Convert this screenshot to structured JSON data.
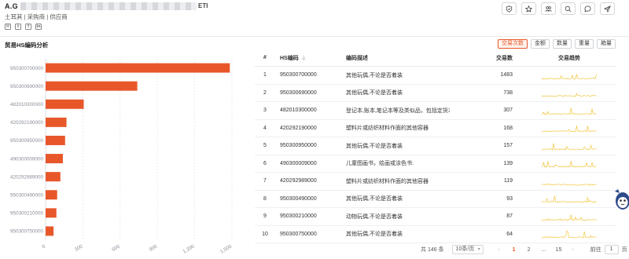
{
  "company": {
    "name": "A.G",
    "name_suffix": "ETI",
    "tags": "土耳其 | 采购商 | 供应商",
    "social_icons": [
      "mail-icon",
      "twitter-icon",
      "facebook-icon",
      "linkedin-icon"
    ]
  },
  "header_actions": [
    "shield-icon",
    "star-icon",
    "users-icon",
    "search-icon",
    "chat-icon",
    "share-icon"
  ],
  "panel": {
    "title": "贸易HS编码分析",
    "metric_tabs": [
      {
        "label": "交易次数",
        "active": true
      },
      {
        "label": "金额",
        "active": false
      },
      {
        "label": "数量",
        "active": false
      },
      {
        "label": "重量",
        "active": false
      },
      {
        "label": "箱量",
        "active": false
      }
    ]
  },
  "chart_data": {
    "type": "bar",
    "orientation": "horizontal",
    "categories": [
      "950300700000",
      "950300690000",
      "482010300000",
      "420292190000",
      "950300950000",
      "490300009000",
      "420292989000",
      "950300490000",
      "950300210000",
      "950300750000"
    ],
    "values": [
      1483,
      738,
      307,
      168,
      157,
      139,
      119,
      93,
      87,
      64
    ],
    "xticks": [
      "0",
      "300",
      "600",
      "900",
      "1,200",
      "1,500"
    ],
    "xlim": [
      0,
      1500
    ],
    "color": "#e8572a",
    "grid": "vertical dashed"
  },
  "table": {
    "headers": {
      "idx": "#",
      "hs": "HS编码",
      "desc": "编码描述",
      "count": "交易数",
      "trend": "交易趋势"
    },
    "rows": [
      {
        "idx": "1",
        "hs": "950300700000",
        "desc": "其他玩偶,不论是否着装",
        "count": "1483"
      },
      {
        "idx": "2",
        "hs": "950300690000",
        "desc": "其他玩偶,不论是否着装",
        "count": "738"
      },
      {
        "idx": "3",
        "hs": "482010300000",
        "desc": "登记本,账本,笔记本等及类似品，包括定货本,收...",
        "count": "307"
      },
      {
        "idx": "4",
        "hs": "420292190000",
        "desc": "塑料片或纺织材料作面的其他容器",
        "count": "168"
      },
      {
        "idx": "5",
        "hs": "950300950000",
        "desc": "其他玩偶,不论是否着装",
        "count": "157"
      },
      {
        "idx": "6",
        "hs": "490300009000",
        "desc": "儿童图画书，绘画或涂色书:",
        "count": "139"
      },
      {
        "idx": "7",
        "hs": "420292989000",
        "desc": "塑料片或纺织材料作面的其他容器",
        "count": "119"
      },
      {
        "idx": "8",
        "hs": "950300490000",
        "desc": "其他玩偶,不论是否着装",
        "count": "93"
      },
      {
        "idx": "9",
        "hs": "950300210000",
        "desc": "动物玩偶,不论是否着装",
        "count": "87"
      },
      {
        "idx": "10",
        "hs": "950300750000",
        "desc": "其他玩偶,不论是否着装",
        "count": "64"
      }
    ],
    "trend_color": "#f2c53d"
  },
  "pagination": {
    "total": "共 146 条",
    "page_size": "10条/页",
    "pages": [
      "1",
      "2",
      "...",
      "15"
    ],
    "current": "1",
    "goto_label": "前往",
    "goto_value": "1",
    "goto_suffix": "页"
  }
}
